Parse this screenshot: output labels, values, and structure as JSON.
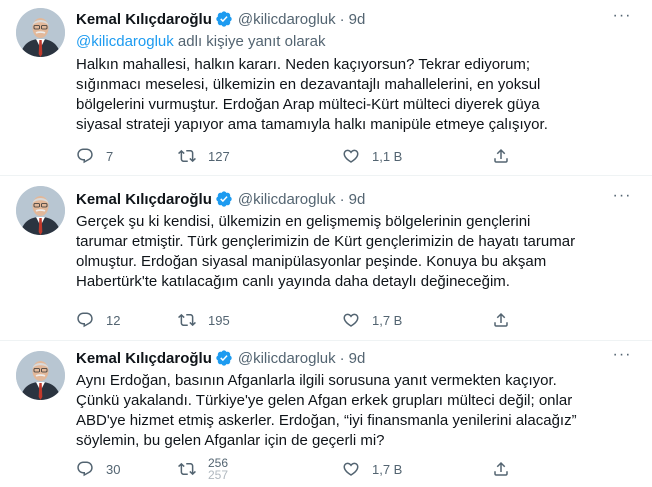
{
  "author": {
    "name": "Kemal Kılıçdaroğlu",
    "handle": "@kilicdarogluk",
    "time": "9d",
    "dot": "·"
  },
  "icons": {
    "verified": "verified-badge-icon",
    "more": "more-options-icon",
    "reply": "reply-icon",
    "retweet": "retweet-icon",
    "like": "heart-icon",
    "share": "share-icon"
  },
  "colors": {
    "link": "#1d9bf0",
    "secondary_text": "#536471",
    "primary_text": "#0f1419"
  },
  "tweets": [
    {
      "reply_to_handle": "@kilicdarogluk",
      "reply_to_suffix": " adlı kişiye yanıt olarak",
      "text": "Halkın mahallesi, halkın kararı. Neden kaçıyorsun? Tekrar ediyorum;\nsığınmacı meselesi, ülkemizin en dezavantajlı mahallelerini, en yoksul\nbölgelerini vurmuştur. Erdoğan Arap mülteci-Kürt mülteci diyerek güya\nsiyasal strateji yapıyor ama tamamıyla halkı manipüle etmeye çalışıyor.",
      "replies": "7",
      "retweets": "127",
      "likes": "1,1 B"
    },
    {
      "text": "Gerçek şu ki kendisi, ülkemizin en gelişmemiş bölgelerinin gençlerini\ntarumar etmiştir. Türk gençlerimizin de Kürt gençlerimizin de hayatı tarumar\nolmuştur. Erdoğan siyasal manipülasyonlar peşinde. Konuya bu akşam\nHabertürk'te katılacağım canlı yayında daha detaylı değineceğim.",
      "replies": "12",
      "retweets": "195",
      "likes": "1,7 B"
    },
    {
      "text": "Aynı Erdoğan, basının Afganlarla ilgili sorusuna yanıt vermekten kaçıyor.\nÇünkü yakalandı. Türkiye'ye gelen Afgan erkek grupları mülteci değil; onlar\nABD'ye hizmet etmiş askerler. Erdoğan, “iyi finansmanla yenilerini alacağız”\nsöylemin, bu gelen Afganlar için de geçerli mi?",
      "replies": "30",
      "retweets": "256",
      "retweets_next": "257",
      "likes": "1,7 B"
    }
  ]
}
